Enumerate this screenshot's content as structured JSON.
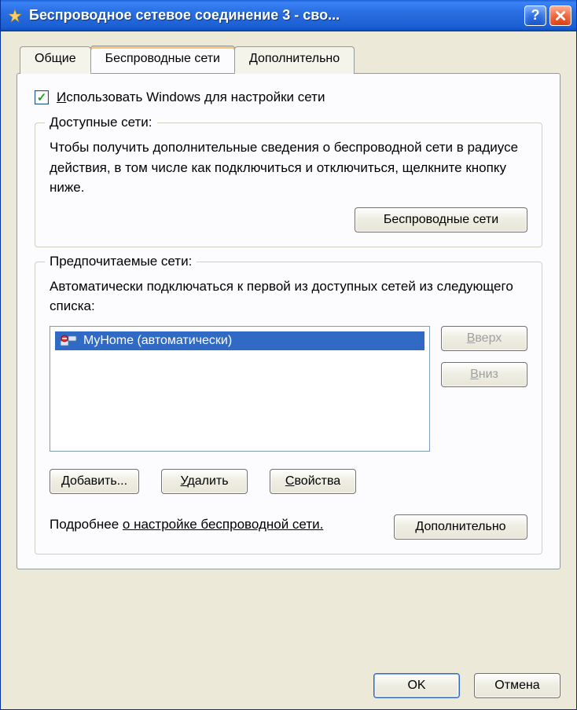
{
  "titlebar": {
    "title": "Беспроводное сетевое соединение 3 - сво..."
  },
  "tabs": {
    "general": "Общие",
    "wireless": "Беспроводные сети",
    "advanced": "Дополнительно"
  },
  "checkbox": {
    "prefix": "И",
    "rest": "спользовать Windows для настройки сети",
    "checked": true
  },
  "available": {
    "legend": "Доступные сети:",
    "text": "Чтобы получить дополнительные сведения о беспроводной сети в радиусе действия, в том числе как подключиться и отключиться, щелкните кнопку ниже.",
    "button": "Беспроводные сети"
  },
  "preferred": {
    "legend": "Предпочитаемые сети:",
    "text": "Автоматически подключаться к первой из доступных сетей из следующего списка:",
    "item": "MyHome (автоматически)",
    "up_u": "В",
    "up_rest": "верх",
    "down_u": "В",
    "down_rest": "низ",
    "add_u": "Д",
    "add_rest": "обавить...",
    "remove_u": "У",
    "remove_rest": "далить",
    "props_u": "С",
    "props_rest": "войства"
  },
  "more": {
    "prefix": "Подробнее ",
    "link": "о настройке беспроводной сети.",
    "button_u": "Д",
    "button_rest": "ополнительно"
  },
  "footer": {
    "ok": "OK",
    "cancel": "Отмена"
  }
}
